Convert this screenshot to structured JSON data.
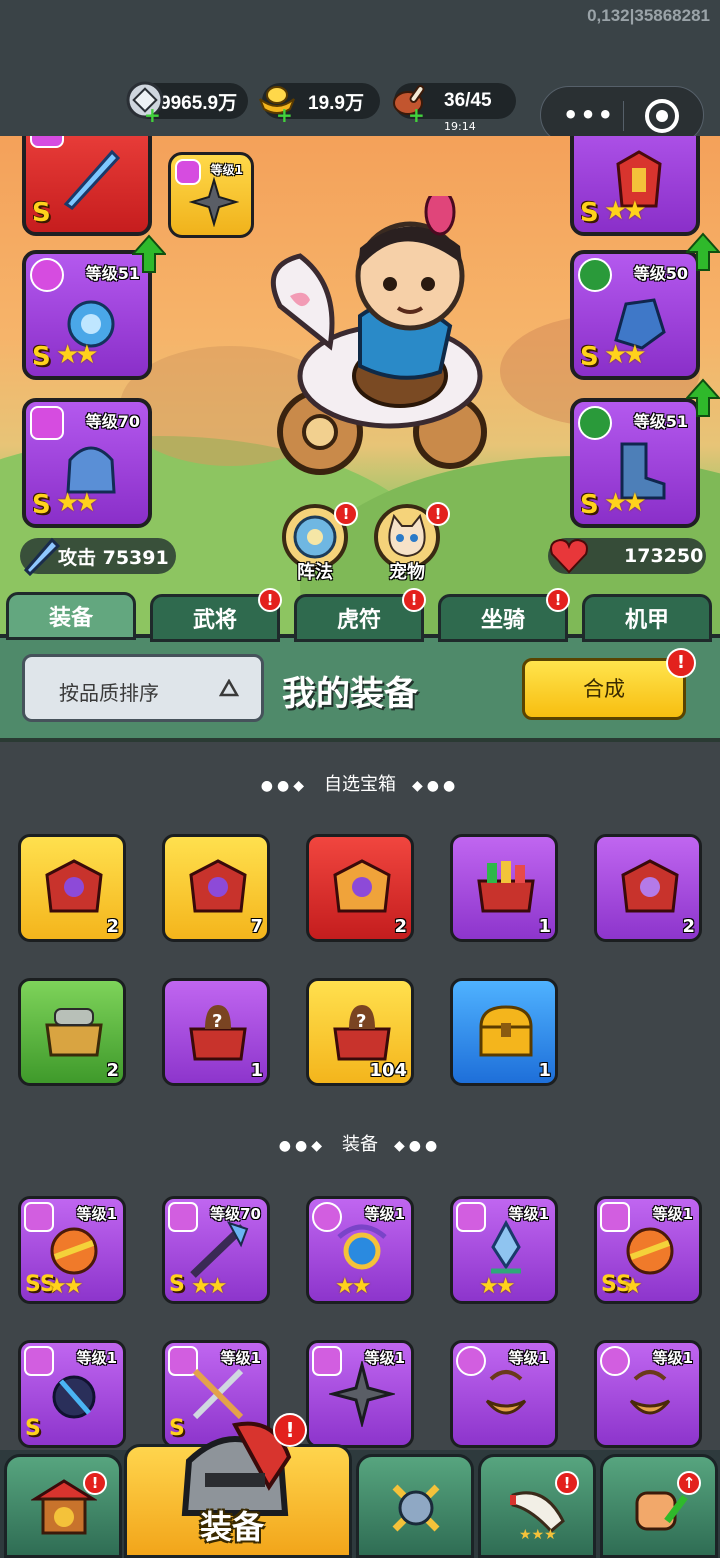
{
  "status": {
    "build_id": "0,132|35868281"
  },
  "resources": {
    "silver": {
      "value": "9965.9万",
      "icon": "silver-coin-icon"
    },
    "gold": {
      "value": "19.9万",
      "icon": "gold-ingot-icon"
    },
    "stamina": {
      "value": "36/45",
      "timer": "19:14",
      "icon": "meat-icon"
    }
  },
  "hero": {
    "left_slots": [
      {
        "grade": "S",
        "level_label": "",
        "stars": "",
        "rarity": "red",
        "icon": "sword-icon"
      },
      {
        "grade": "S",
        "level_label": "等级51",
        "stars": "★★",
        "rarity": "purple",
        "icon": "medal-icon"
      },
      {
        "grade": "S",
        "level_label": "等级70",
        "stars": "★★",
        "rarity": "purple",
        "icon": "helmet-icon"
      }
    ],
    "right_slots": [
      {
        "grade": "S",
        "level_label": "",
        "stars": "★★",
        "rarity": "purple",
        "icon": "armor-icon"
      },
      {
        "grade": "S",
        "level_label": "等级50",
        "stars": "★★",
        "rarity": "purple",
        "icon": "yinyang-icon"
      },
      {
        "grade": "S",
        "level_label": "等级51",
        "stars": "★★",
        "rarity": "purple",
        "icon": "yinyang-icon"
      }
    ],
    "mini_slot": {
      "level_label": "等级1"
    },
    "attack": "攻击 75391",
    "hp": "173250",
    "formation_label": "阵法",
    "pet_label": "宠物"
  },
  "tabs": [
    {
      "label": "装备",
      "active": true,
      "alert": false
    },
    {
      "label": "武将",
      "active": false,
      "alert": true
    },
    {
      "label": "虎符",
      "active": false,
      "alert": true
    },
    {
      "label": "坐骑",
      "active": false,
      "alert": true
    },
    {
      "label": "机甲",
      "active": false,
      "alert": false
    }
  ],
  "toolbar": {
    "sort_label": "按品质排序",
    "title": "我的装备",
    "combine_label": "合成",
    "alert_glyph": "!"
  },
  "chest_section": {
    "title": "自选宝箱",
    "items": [
      {
        "rarity": "gold",
        "count": "2",
        "icon": "chest-icon"
      },
      {
        "rarity": "gold",
        "count": "7",
        "icon": "chest-icon"
      },
      {
        "rarity": "red",
        "count": "2",
        "icon": "chest-icon"
      },
      {
        "rarity": "purple",
        "count": "1",
        "icon": "chest-icon"
      },
      {
        "rarity": "purple",
        "count": "2",
        "icon": "chest-icon"
      },
      {
        "rarity": "green",
        "count": "2",
        "icon": "chest-icon"
      },
      {
        "rarity": "purple",
        "count": "1",
        "icon": "mystery-chest-icon"
      },
      {
        "rarity": "gold",
        "count": "104",
        "icon": "mystery-chest-icon"
      },
      {
        "rarity": "blue",
        "count": "1",
        "icon": "treasure-chest-icon"
      }
    ]
  },
  "equipment_section": {
    "title": "装备",
    "items": [
      {
        "level_label": "等级1",
        "grade": "SS",
        "stars": "★★",
        "icon": "sword-icon"
      },
      {
        "level_label": "等级70",
        "grade": "S",
        "stars": "★★",
        "icon": "sword-icon"
      },
      {
        "level_label": "等级1",
        "grade": "",
        "stars": "★★",
        "icon": "medal-icon"
      },
      {
        "level_label": "等级1",
        "grade": "",
        "stars": "★★",
        "icon": "helmet-icon"
      },
      {
        "level_label": "等级1",
        "grade": "SS",
        "stars": "★",
        "icon": "sword-icon"
      },
      {
        "level_label": "等级1",
        "grade": "S",
        "stars": "",
        "icon": "sword-icon"
      },
      {
        "level_label": "等级1",
        "grade": "S",
        "stars": "",
        "icon": "sword-icon"
      },
      {
        "level_label": "等级1",
        "grade": "",
        "stars": "",
        "icon": "sword-icon"
      },
      {
        "level_label": "等级1",
        "grade": "",
        "stars": "",
        "icon": "medal-icon"
      },
      {
        "level_label": "等级1",
        "grade": "",
        "stars": "",
        "icon": "medal-icon"
      }
    ]
  },
  "bottom_nav": {
    "active_label": "装备"
  },
  "colors": {
    "gold": "#f4b51c",
    "purple": "#8d35cc",
    "red": "#c41d1e",
    "green": "#3f9a2b",
    "blue": "#1e6fd9",
    "alert": "#e3211d"
  }
}
